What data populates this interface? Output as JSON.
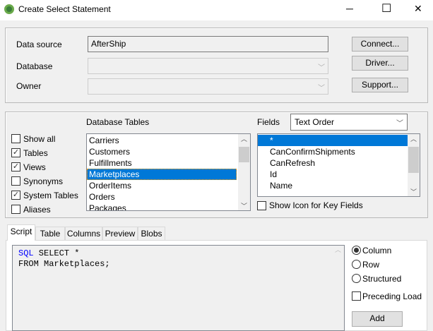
{
  "window": {
    "title": "Create Select Statement",
    "minimize": "─",
    "maximize": "☐",
    "close": "✕"
  },
  "connection": {
    "data_source_label": "Data source",
    "data_source_value": "AfterShip",
    "database_label": "Database",
    "owner_label": "Owner",
    "connect": "Connect...",
    "driver": "Driver...",
    "support": "Support..."
  },
  "tables": {
    "label": "Database Tables",
    "items": [
      "Carriers",
      "Customers",
      "Fulfillments",
      "Marketplaces",
      "OrderItems",
      "Orders",
      "Packages"
    ],
    "selected": "Marketplaces"
  },
  "options": [
    {
      "label": "Show all",
      "checked": false
    },
    {
      "label": "Tables",
      "checked": true
    },
    {
      "label": "Views",
      "checked": true
    },
    {
      "label": "Synonyms",
      "checked": false
    },
    {
      "label": "System Tables",
      "checked": true
    },
    {
      "label": "Aliases",
      "checked": false
    }
  ],
  "fields": {
    "label": "Fields",
    "order": "Text Order",
    "items": [
      "*",
      "CanConfirmShipments",
      "CanRefresh",
      "Id",
      "Name"
    ],
    "show_key_icon_label": "Show Icon for Key Fields"
  },
  "tabs": [
    "Script",
    "Table",
    "Columns",
    "Preview",
    "Blobs"
  ],
  "script": {
    "line1_kw": "SQL",
    "line1_rest": " SELECT *",
    "line2": "FROM Marketplaces;"
  },
  "layout_options": {
    "radios": [
      {
        "label": "Column",
        "selected": true
      },
      {
        "label": "Row",
        "selected": false
      },
      {
        "label": "Structured",
        "selected": false
      }
    ],
    "preceding_load": "Preceding Load",
    "add": "Add"
  }
}
